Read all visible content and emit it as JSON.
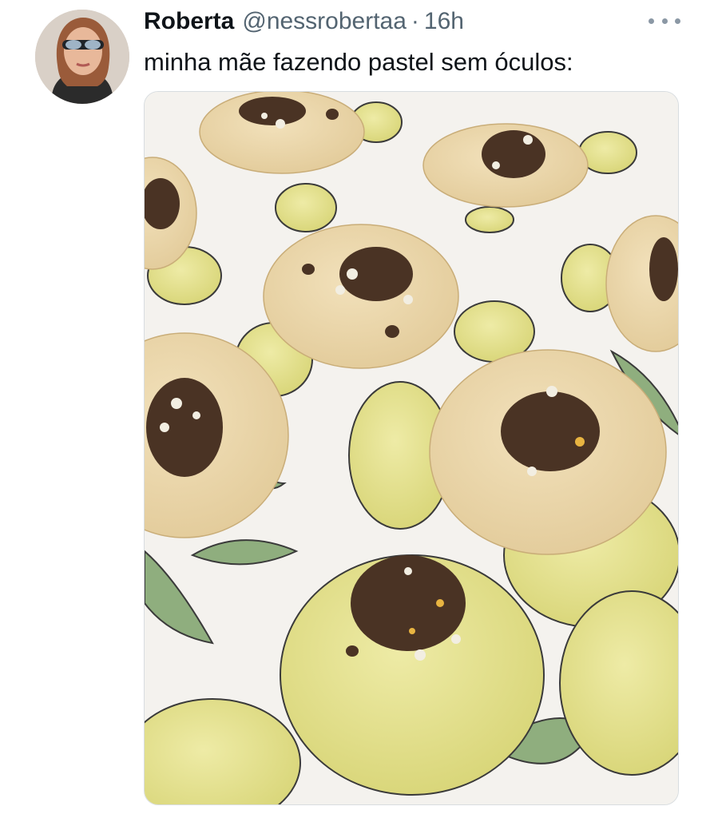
{
  "tweet": {
    "display_name": "Roberta",
    "handle": "@nessrobertaa",
    "separator": "·",
    "time": "16h",
    "text": "minha mãe fazendo pastel sem óculos:",
    "more_icon": "more-horizontal-icon"
  },
  "colors": {
    "name": "#0f1419",
    "muted": "#536471",
    "lemon": "#e2df8a",
    "dough": "#ead7ad",
    "meat": "#4a3324",
    "leaf": "#8fae7e"
  }
}
